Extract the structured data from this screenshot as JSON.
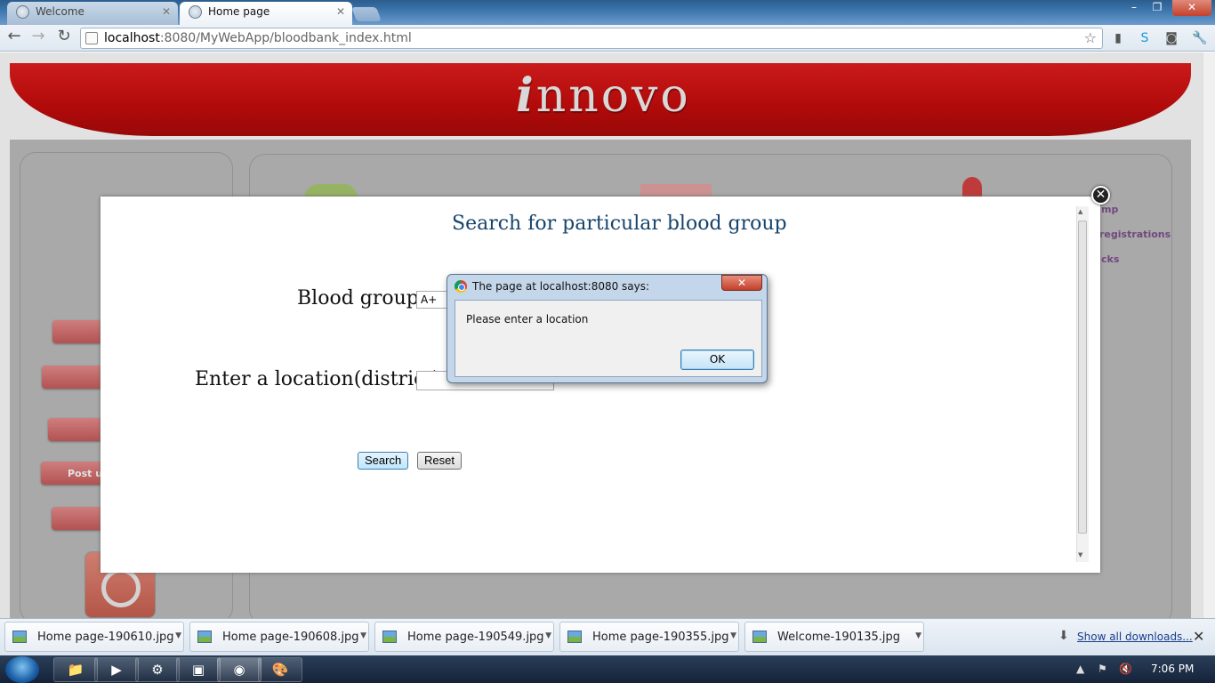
{
  "browser": {
    "tabs": [
      {
        "title": "Welcome",
        "active": false
      },
      {
        "title": "Home page",
        "active": true
      }
    ],
    "url_host": "localhost",
    "url_rest": ":8080/MyWebApp/bloodbank_index.html"
  },
  "site": {
    "logo": "innovo",
    "sidebar_buttons": [
      "Post u"
    ],
    "faded_links": [
      "mp",
      "registrations",
      "cks"
    ]
  },
  "modal": {
    "title": "Search for particular blood group",
    "blood_group_label": "Blood group:",
    "blood_group_value": "A+",
    "location_label": "Enter a location(district):",
    "location_value": "",
    "search_label": "Search",
    "reset_label": "Reset"
  },
  "alert": {
    "title": "The page at localhost:8080 says:",
    "message": "Please enter a location",
    "ok_label": "OK"
  },
  "downloads": {
    "items": [
      "Home page-190610.jpg",
      "Home page-190608.jpg",
      "Home page-190549.jpg",
      "Home page-190355.jpg",
      "Welcome-190135.jpg"
    ],
    "show_all": "Show all downloads..."
  },
  "taskbar": {
    "clock": "7:06 PM"
  }
}
